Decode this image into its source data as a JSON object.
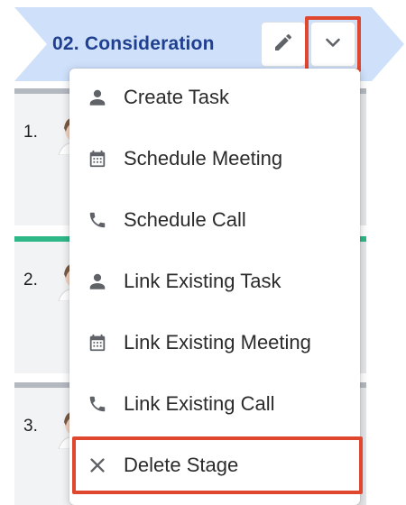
{
  "colors": {
    "stage_fill": "#cfe0fb",
    "stage_text": "#1f3f8f",
    "highlight": "#e0472f",
    "icon": "#5f6368",
    "card_bar_gray": "#b4b8bf",
    "card_bar_green": "#2fb887"
  },
  "stage": {
    "title": "02. Consideration",
    "edit_icon": "pencil-icon",
    "dropdown_icon": "chevron-down-icon"
  },
  "cards": [
    {
      "number": "1.",
      "bar": "gray"
    },
    {
      "number": "2.",
      "bar": "green"
    },
    {
      "number": "3.",
      "bar": "gray"
    }
  ],
  "menu": {
    "items": [
      {
        "label": "Create Task",
        "icon": "person-icon"
      },
      {
        "label": "Schedule Meeting",
        "icon": "calendar-icon"
      },
      {
        "label": "Schedule Call",
        "icon": "phone-icon"
      },
      {
        "label": "Link Existing Task",
        "icon": "person-icon"
      },
      {
        "label": "Link Existing Meeting",
        "icon": "calendar-icon"
      },
      {
        "label": "Link Existing Call",
        "icon": "phone-icon"
      },
      {
        "label": "Delete Stage",
        "icon": "close-icon"
      }
    ]
  }
}
